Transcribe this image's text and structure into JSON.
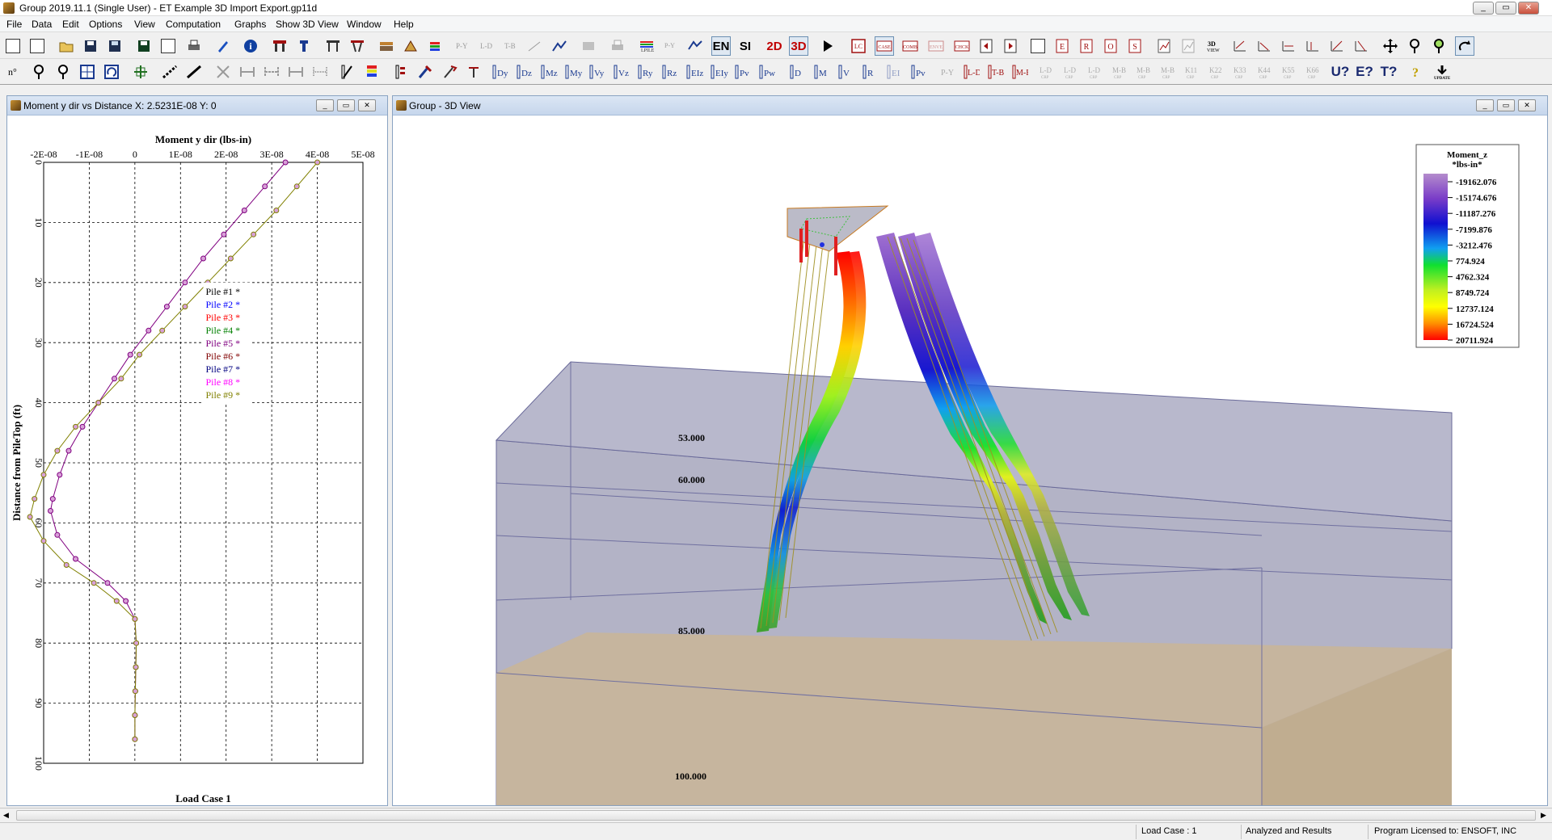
{
  "app": {
    "title": "Group 2019.11.1 (Single User) - ET Example 3D Import Export.gp11d"
  },
  "menu": [
    "File",
    "Data",
    "Edit",
    "Options",
    "View",
    "Computation",
    "Graphs",
    "Show 3D View",
    "Window",
    "Help"
  ],
  "toolbar1": {
    "en_label": "EN",
    "si_label": "SI",
    "view2d_label": "2D",
    "view3d_label": "3D"
  },
  "toolbar2": {
    "help_u": "U?",
    "help_e": "E?",
    "help_t": "T?"
  },
  "graph_window": {
    "title": "Moment y dir vs Distance X: 2.5231E-08 Y: 0",
    "chart_data": {
      "type": "line",
      "title": "Moment y dir (lbs-in)",
      "ylabel": "Distance from PileTop (ft)",
      "xlim": [
        -2e-08,
        5e-08
      ],
      "ylim": [
        0,
        100
      ],
      "y_inverted": true,
      "grid": true,
      "x_tick_labels": [
        "-2E-08",
        "-1E-08",
        "0",
        "1E-08",
        "2E-08",
        "3E-08",
        "4E-08",
        "5E-08"
      ],
      "y_tick_labels": [
        "0",
        "10",
        "20",
        "30",
        "40",
        "50",
        "60",
        "70",
        "80",
        "90",
        "100"
      ],
      "legend": {
        "placement": "center-right",
        "entries": [
          "Pile #1 *",
          "Pile #2 *",
          "Pile #3 *",
          "Pile #4 *",
          "Pile #5 *",
          "Pile #6 *",
          "Pile #7 *",
          "Pile #8 *",
          "Pile #9 *"
        ],
        "colors": [
          "#000000",
          "#0000ff",
          "#ff0000",
          "#008000",
          "#800080",
          "#800000",
          "#000080",
          "#ff00ff",
          "#808000"
        ]
      },
      "series": [
        {
          "name": "Pile #5 *",
          "color": "#800080",
          "points": [
            [
              3.3e-08,
              0
            ],
            [
              2.85e-08,
              4
            ],
            [
              2.4e-08,
              8
            ],
            [
              1.95e-08,
              12
            ],
            [
              1.5e-08,
              16
            ],
            [
              1.1e-08,
              20
            ],
            [
              7e-09,
              24
            ],
            [
              3e-09,
              28
            ],
            [
              -1e-09,
              32
            ],
            [
              -4.5e-09,
              36
            ],
            [
              -8e-09,
              40
            ],
            [
              -1.15e-08,
              44
            ],
            [
              -1.45e-08,
              48
            ],
            [
              -1.65e-08,
              52
            ],
            [
              -1.8e-08,
              56
            ],
            [
              -1.85e-08,
              58
            ],
            [
              -1.7e-08,
              62
            ],
            [
              -1.3e-08,
              66
            ],
            [
              -6e-09,
              70
            ],
            [
              -2e-09,
              73
            ],
            [
              0,
              76
            ],
            [
              3e-10,
              80
            ],
            [
              2e-10,
              84
            ],
            [
              1e-10,
              88
            ],
            [
              0,
              92
            ],
            [
              0,
              96
            ]
          ]
        },
        {
          "name": "Pile #9 *",
          "color": "#808000",
          "points": [
            [
              4e-08,
              0
            ],
            [
              3.55e-08,
              4
            ],
            [
              3.1e-08,
              8
            ],
            [
              2.6e-08,
              12
            ],
            [
              2.1e-08,
              16
            ],
            [
              1.6e-08,
              20
            ],
            [
              1.1e-08,
              24
            ],
            [
              6e-09,
              28
            ],
            [
              1e-09,
              32
            ],
            [
              -3e-09,
              36
            ],
            [
              -8e-09,
              40
            ],
            [
              -1.3e-08,
              44
            ],
            [
              -1.7e-08,
              48
            ],
            [
              -2e-08,
              52
            ],
            [
              -2.2e-08,
              56
            ],
            [
              -2.3e-08,
              59
            ],
            [
              -2e-08,
              63
            ],
            [
              -1.5e-08,
              67
            ],
            [
              -9e-09,
              70
            ],
            [
              -4e-09,
              73
            ],
            [
              0,
              76
            ],
            [
              3e-10,
              80
            ],
            [
              2e-10,
              84
            ],
            [
              1e-10,
              88
            ],
            [
              0,
              92
            ],
            [
              0,
              96
            ]
          ]
        }
      ],
      "footer": "Load Case 1"
    }
  },
  "view3d_window": {
    "title": "Group - 3D View",
    "legend": {
      "title": "Moment_z",
      "unit": "*lbs-in*",
      "values": [
        "-19162.076",
        "-15174.676",
        "-11187.276",
        "-7199.876",
        "-3212.476",
        "774.924",
        "4762.324",
        "8749.724",
        "12737.124",
        "16724.524",
        "20711.924"
      ]
    },
    "layer_labels": [
      "53.000",
      "60.000",
      "85.000",
      "100.000"
    ]
  },
  "status": {
    "load_case": "Load Case : 1",
    "analyzed": "Analyzed and Results",
    "license": "Program Licensed to: ENSOFT, INC"
  }
}
